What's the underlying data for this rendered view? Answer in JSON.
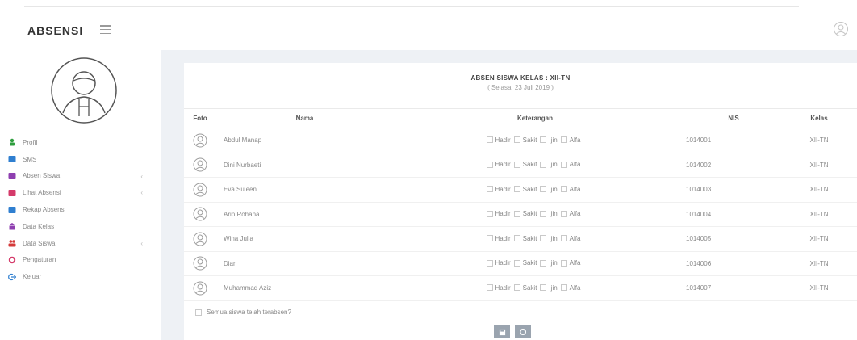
{
  "app": {
    "brand": "ABSENSI"
  },
  "sidebar": {
    "items": [
      {
        "label": "Profil",
        "icon": "person-icon",
        "color": "#2e9e3e",
        "has_submenu": false
      },
      {
        "label": "SMS",
        "icon": "message-icon",
        "color": "#2f7fd0",
        "has_submenu": false
      },
      {
        "label": "Absen Siswa",
        "icon": "check-box-icon",
        "color": "#8e3fb0",
        "has_submenu": true
      },
      {
        "label": "Lihat Absensi",
        "icon": "report-icon",
        "color": "#d43a6a",
        "has_submenu": true
      },
      {
        "label": "Rekap Absensi",
        "icon": "archive-icon",
        "color": "#2f7fd0",
        "has_submenu": false
      },
      {
        "label": "Data Kelas",
        "icon": "school-icon",
        "color": "#8e3fb0",
        "has_submenu": false
      },
      {
        "label": "Data Siswa",
        "icon": "group-icon",
        "color": "#d43a3a",
        "has_submenu": true
      },
      {
        "label": "Pengaturan",
        "icon": "gear-icon",
        "color": "#d43a6a",
        "has_submenu": false
      },
      {
        "label": "Keluar",
        "icon": "logout-icon",
        "color": "#2f7fd0",
        "has_submenu": false
      }
    ]
  },
  "panel": {
    "title": "ABSEN SISWA KELAS : XII-TN",
    "subtitle": "( Selasa, 23 Juli 2019 )"
  },
  "table": {
    "headers": {
      "foto": "Foto",
      "nama": "Nama",
      "keterangan": "Keterangan",
      "nis": "NIS",
      "kelas": "Kelas"
    },
    "options": [
      "Hadir",
      "Sakit",
      "Ijin",
      "Alfa"
    ],
    "rows": [
      {
        "nama": "Abdul Manap",
        "nis": "1014001",
        "kelas": "XII-TN"
      },
      {
        "nama": "Dini Nurbaeti",
        "nis": "1014002",
        "kelas": "XII-TN"
      },
      {
        "nama": "Eva Suleen",
        "nis": "1014003",
        "kelas": "XII-TN"
      },
      {
        "nama": "Arip Rohana",
        "nis": "1014004",
        "kelas": "XII-TN"
      },
      {
        "nama": "Wina Julia",
        "nis": "1014005",
        "kelas": "XII-TN"
      },
      {
        "nama": "Dian",
        "nis": "1014006",
        "kelas": "XII-TN"
      },
      {
        "nama": "Muhammad Aziz",
        "nis": "1014007",
        "kelas": "XII-TN"
      }
    ]
  },
  "confirm": {
    "label": "Semua siswa telah terabsen?"
  },
  "buttons": {
    "save_icon": "save-icon",
    "refresh_icon": "refresh-icon"
  }
}
